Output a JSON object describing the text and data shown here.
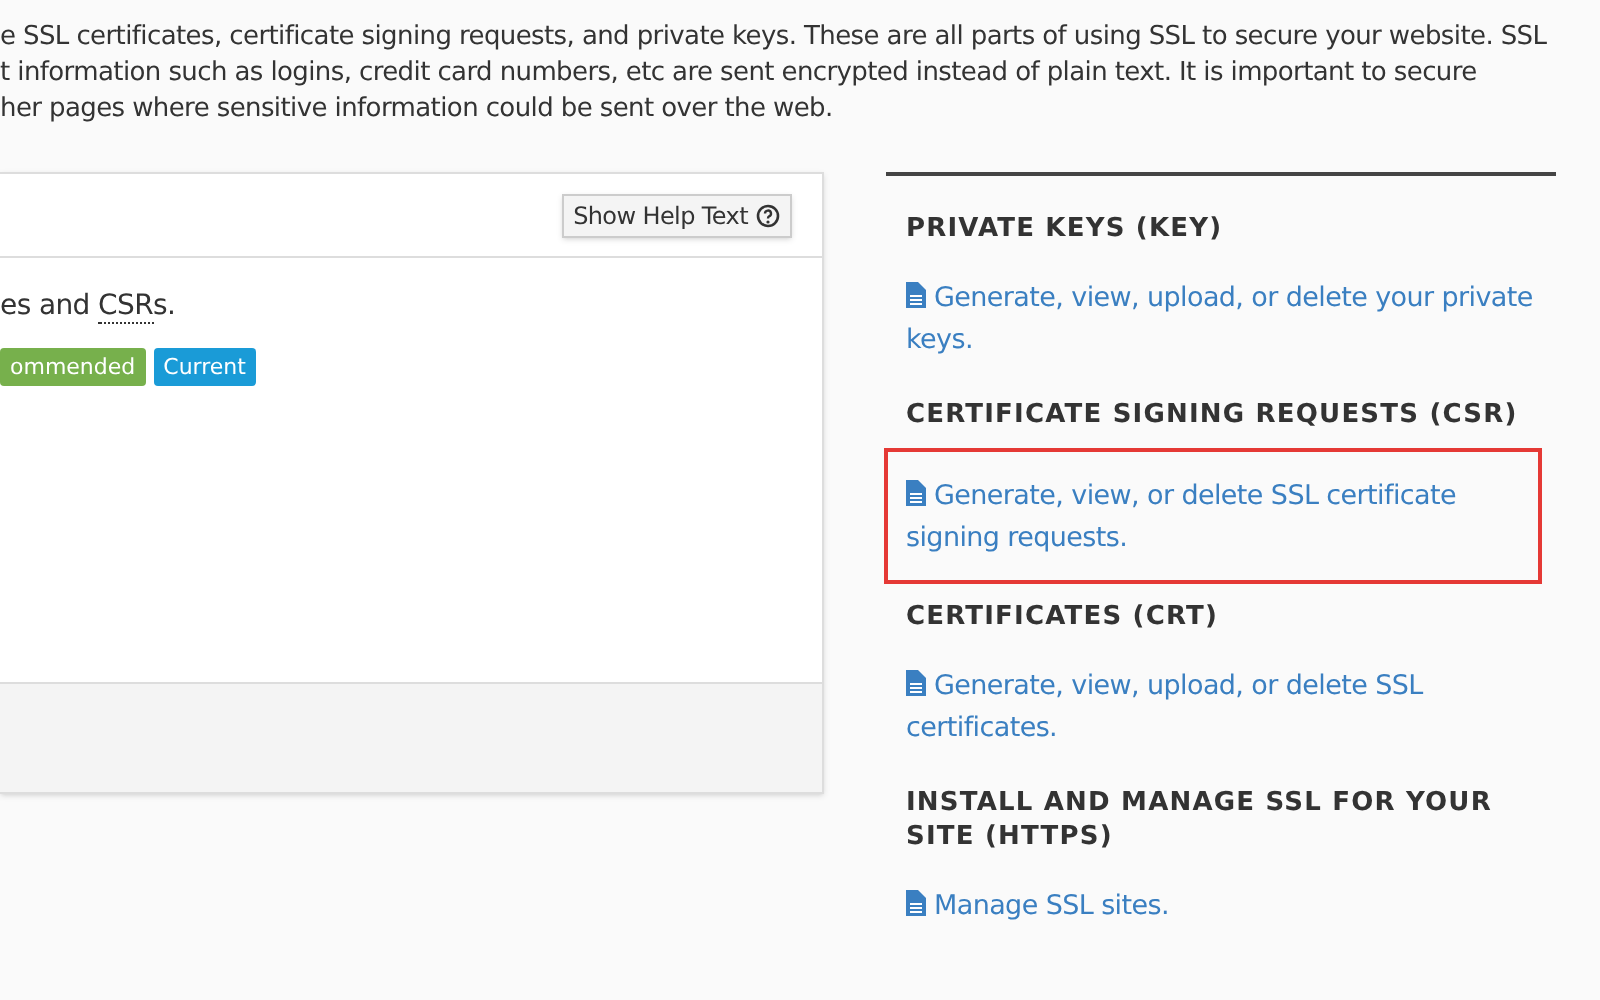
{
  "intro_lines": [
    "e SSL certificates, certificate signing requests, and private keys. These are all parts of using SSL to secure your website. SSL",
    "t information such as logins, credit card numbers, etc are sent encrypted instead of plain text. It is important to secure",
    "her pages where sensitive information could be sent over the web."
  ],
  "panel": {
    "help_button": "Show Help Text",
    "body_text": "es and ",
    "abbr": "CSR",
    "body_tail": "s.",
    "badges": [
      {
        "label": "ommended",
        "color": "#77b04c"
      },
      {
        "label": "Current",
        "color": "#1a9bd7"
      }
    ]
  },
  "sections": [
    {
      "heading": "PRIVATE KEYS (KEY)",
      "link": "Generate, view, upload, or delete your private keys.",
      "highlighted": false
    },
    {
      "heading": "CERTIFICATE SIGNING REQUESTS (CSR)",
      "link": "Generate, view, or delete SSL certificate signing requests.",
      "highlighted": true
    },
    {
      "heading": "CERTIFICATES (CRT)",
      "link": "Generate, view, upload, or delete SSL certificates.",
      "highlighted": false
    },
    {
      "heading": "INSTALL AND MANAGE SSL FOR YOUR SITE (HTTPS)",
      "link": "Manage SSL sites.",
      "highlighted": false
    }
  ]
}
